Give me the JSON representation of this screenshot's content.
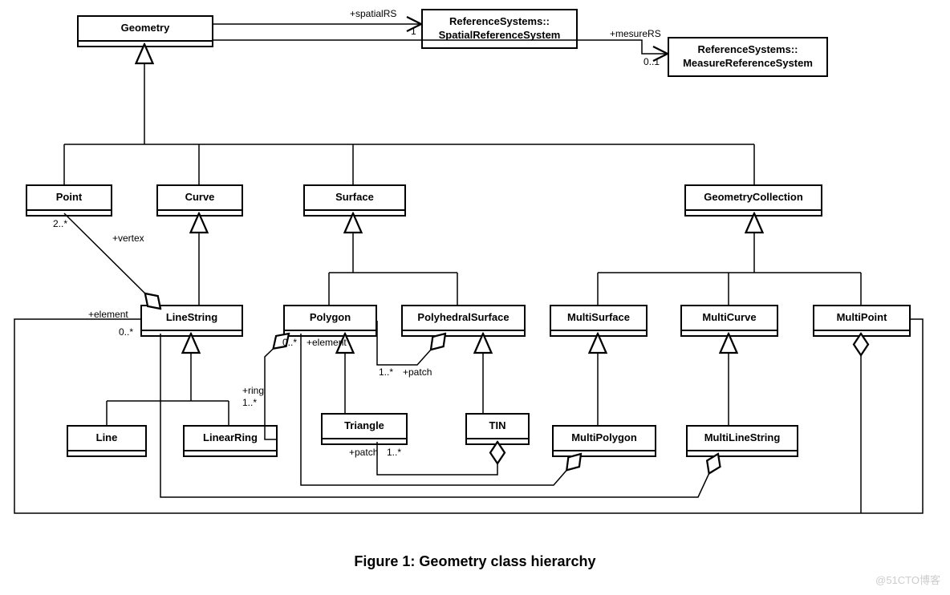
{
  "classes": {
    "geometry": "Geometry",
    "referenceSystemsSpatial": "ReferenceSystems::\nSpatialReferenceSystem",
    "referenceSystemsMeasure": "ReferenceSystems::\nMeasureReferenceSystem",
    "point": "Point",
    "curve": "Curve",
    "surface": "Surface",
    "geometryCollection": "GeometryCollection",
    "lineString": "LineString",
    "polygon": "Polygon",
    "polyhedralSurface": "PolyhedralSurface",
    "multiSurface": "MultiSurface",
    "multiCurve": "MultiCurve",
    "multiPoint": "MultiPoint",
    "line": "Line",
    "linearRing": "LinearRing",
    "triangle": "Triangle",
    "tin": "TIN",
    "multiPolygon": "MultiPolygon",
    "multiLineString": "MultiLineString"
  },
  "labels": {
    "spatialRS": "+spatialRS",
    "one": "1",
    "mesureRS": "+mesureRS",
    "zeroOne": "0..1",
    "twoStar": "2..*",
    "vertex": "+vertex",
    "element": "+element",
    "zeroStar": "0..*",
    "ring": "+ring",
    "oneStar": "1..*",
    "patch": "+patch"
  },
  "caption": "Figure 1: Geometry class hierarchy",
  "watermark": "@51CTO博客"
}
